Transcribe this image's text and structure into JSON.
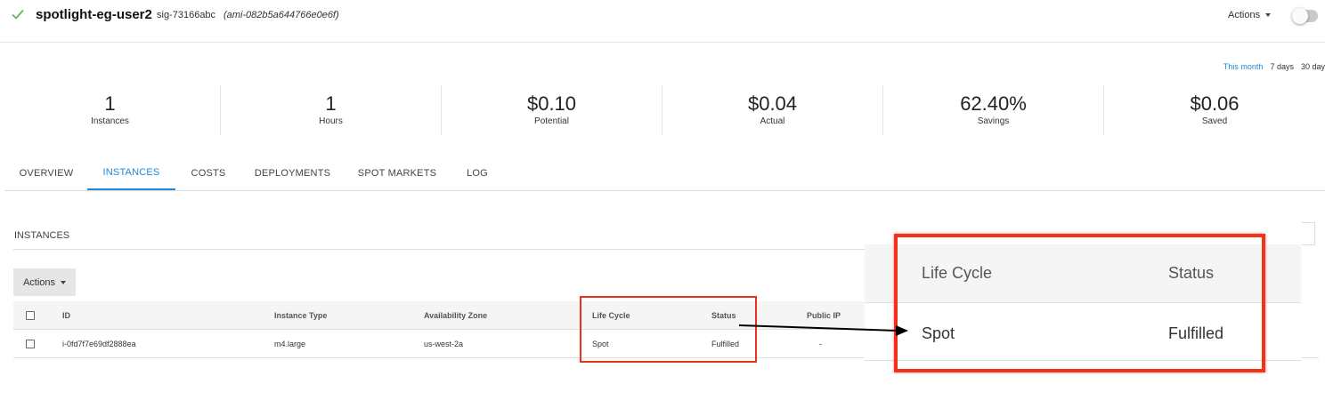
{
  "header": {
    "group_name": "spotlight-eg-user2",
    "group_id": "sig-73166abc",
    "ami_id": "(ami-082b5a644766e0e6f)",
    "actions_label": "Actions",
    "status_icon": "check-icon"
  },
  "periods": [
    "This month",
    "7 days",
    "30 day"
  ],
  "stats": [
    {
      "value": "1",
      "label": "Instances"
    },
    {
      "value": "1",
      "label": "Hours"
    },
    {
      "value": "$0.10",
      "label": "Potential"
    },
    {
      "value": "$0.04",
      "label": "Actual"
    },
    {
      "value": "62.40%",
      "label": "Savings"
    },
    {
      "value": "$0.06",
      "label": "Saved"
    }
  ],
  "tabs": [
    "OVERVIEW",
    "INSTANCES",
    "COSTS",
    "DEPLOYMENTS",
    "SPOT MARKETS",
    "LOG"
  ],
  "active_tab": "INSTANCES",
  "instances": {
    "section_title": "INSTANCES",
    "actions_label": "Actions",
    "columns": [
      "ID",
      "Instance Type",
      "Availability Zone",
      "Life Cycle",
      "Status",
      "Public IP"
    ],
    "rows": [
      {
        "id": "i-0fd7f7e69df2888ea",
        "type": "m4.large",
        "zone": "us-west-2a",
        "lifecycle": "Spot",
        "status": "Fulfilled",
        "public_ip": "-"
      }
    ]
  },
  "zoom": {
    "col_lifecycle": "Life Cycle",
    "col_status": "Status",
    "lifecycle": "Spot",
    "status": "Fulfilled"
  },
  "colors": {
    "accent": "#1f88d8",
    "highlight": "#f2321c",
    "check": "#5cb85c"
  }
}
